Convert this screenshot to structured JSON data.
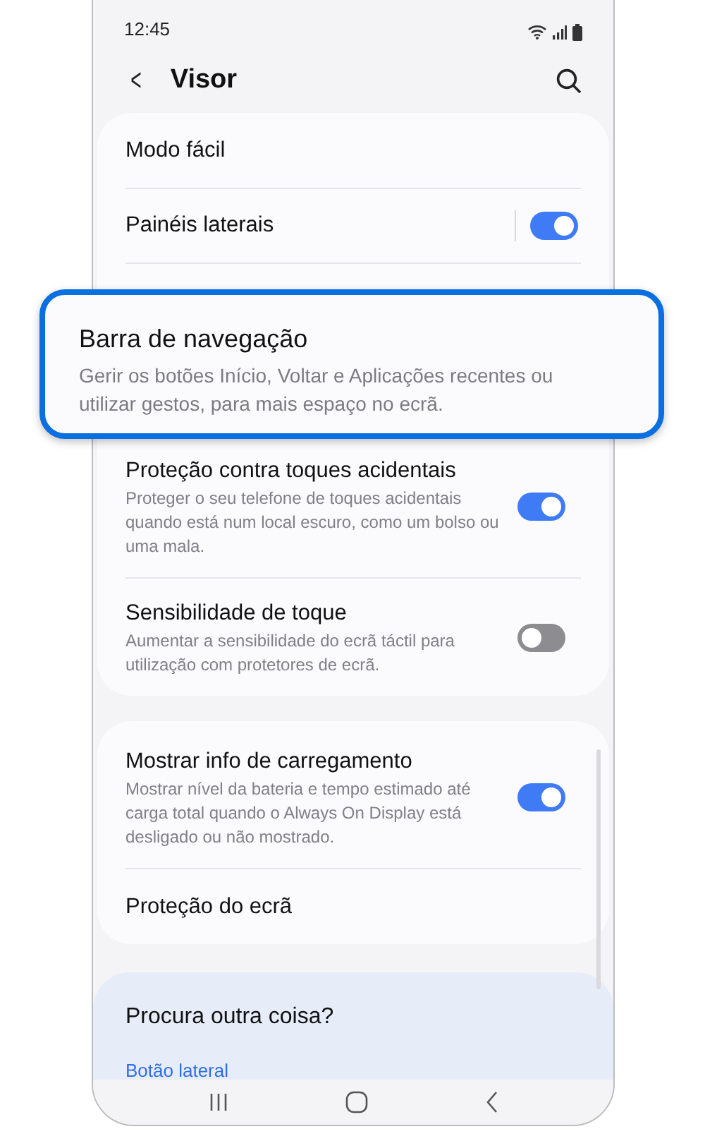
{
  "status_bar": {
    "time": "12:45"
  },
  "header": {
    "back": "<",
    "title": "Visor"
  },
  "card_1": [
    {
      "title": "Modo fácil"
    },
    {
      "title": "Painéis laterais",
      "on": true,
      "divider": true
    }
  ],
  "highlight": {
    "title": "Barra de navegação",
    "description": "Gerir os botões Início, Voltar e Aplicações recentes ou utilizar gestos, para mais espaço no ecrã."
  },
  "card_1_after": [
    {
      "title": "Proteção contra toques acidentais",
      "description": "Proteger o seu telefone de toques acidentais quando está num local escuro, como um bolso ou uma mala.",
      "on": true
    },
    {
      "title": "Sensibilidade de toque",
      "description": "Aumentar a sensibilidade do ecrã táctil para utilização com protetores de ecrã.",
      "on": false
    }
  ],
  "card_2": [
    {
      "title": "Mostrar info de carregamento",
      "description": "Mostrar nível da bateria e tempo estimado até carga total quando o Always On Display está desligado ou não mostrado.",
      "on": true
    },
    {
      "title": "Proteção do ecrã"
    }
  ],
  "suggestions": {
    "title": "Procura outra coisa?",
    "link": "Botão lateral"
  }
}
